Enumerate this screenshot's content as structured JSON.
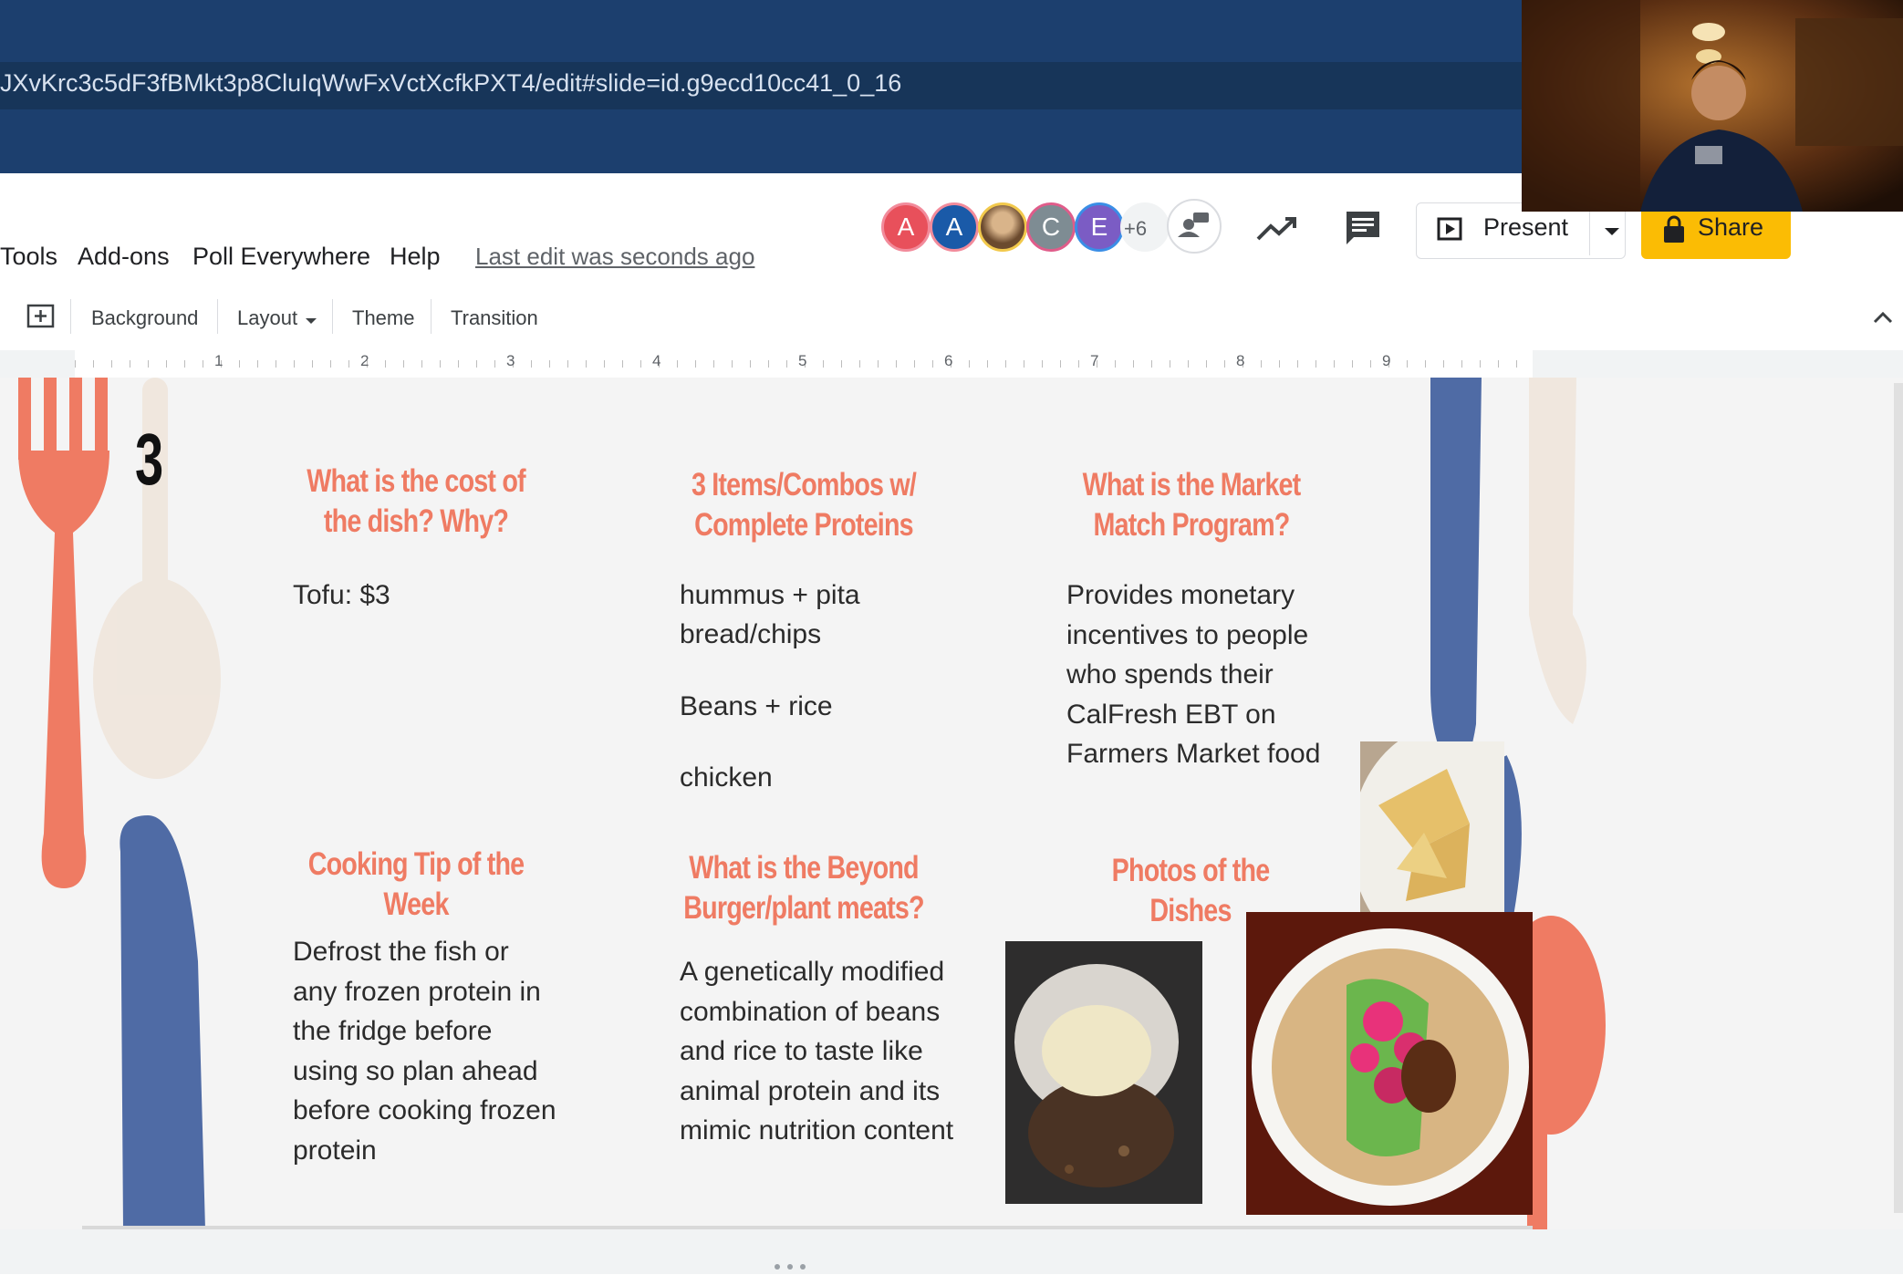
{
  "browser": {
    "url": "JXvKrc3c5dF3fBMkt3p8CluIqWwFxVctXcfkPXT4/edit#slide=id.g9ecd10cc41_0_16"
  },
  "menu": {
    "items": [
      "Tools",
      "Add-ons",
      "Poll Everywhere",
      "Help"
    ],
    "last_edit": "Last edit was seconds ago"
  },
  "collaborators": {
    "avatars": [
      {
        "letter": "A",
        "color": "#e8505b",
        "ring": "#f28b9b"
      },
      {
        "letter": "A",
        "color": "#1a5aa8",
        "ring": "#f28b9b"
      },
      {
        "letter": "",
        "color": "#a07b5a",
        "ring": "#f2c94c"
      },
      {
        "letter": "C",
        "color": "#7e8c93",
        "ring": "#e05c8a"
      },
      {
        "letter": "E",
        "color": "#7b5cc4",
        "ring": "#3a8ee6"
      }
    ],
    "more": "+6"
  },
  "header": {
    "present_label": "Present",
    "share_label": "Share",
    "share_color": "#fbbc04"
  },
  "toolbar": {
    "background": "Background",
    "layout": "Layout",
    "theme": "Theme",
    "transition": "Transition"
  },
  "ruler": [
    "1",
    "2",
    "3",
    "4",
    "5",
    "6",
    "7",
    "8",
    "9"
  ],
  "slide": {
    "number": "3",
    "accent_color": "#ef7b63",
    "sections": {
      "cost": {
        "heading": "What is the cost of the dish? Why?",
        "body": "Tofu: $3"
      },
      "combos": {
        "heading": "3 Items/Combos w/ Complete Proteins",
        "line1": "hummus + pita",
        "line2": "bread/chips",
        "line3": "Beans + rice",
        "line4": "chicken"
      },
      "market": {
        "heading": "What is the Market Match Program?",
        "body": "Provides monetary incentives to people who spends their CalFresh EBT on Farmers Market food"
      },
      "tip": {
        "heading": "Cooking Tip of the Week",
        "body": "Defrost the fish or any frozen protein in the fridge before using so plan ahead before cooking frozen protein"
      },
      "beyond": {
        "heading": "What is the Beyond Burger/plant meats?",
        "body": "A genetically modified combination of beans and rice to taste like animal protein and its mimic nutrition content"
      },
      "photos": {
        "heading": "Photos of the Dishes"
      }
    }
  }
}
